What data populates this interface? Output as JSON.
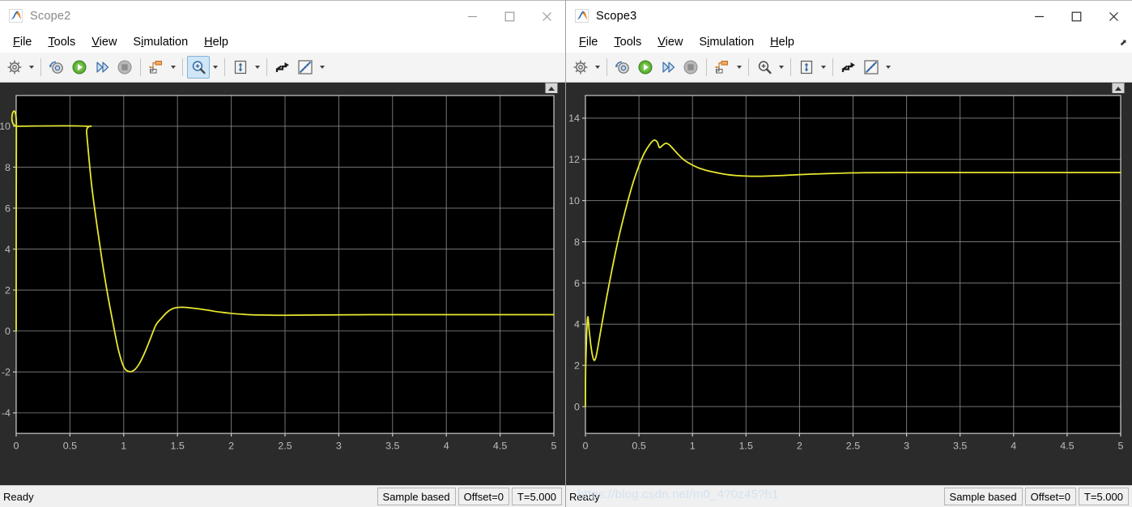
{
  "windows": [
    {
      "id": "scope2",
      "title": "Scope2",
      "active": false,
      "icon": "matlab-scope-icon",
      "menus": [
        {
          "label": "File",
          "mnemonic": "F"
        },
        {
          "label": "Tools",
          "mnemonic": "T"
        },
        {
          "label": "View",
          "mnemonic": "V"
        },
        {
          "label": "Simulation",
          "mnemonic": "i"
        },
        {
          "label": "Help",
          "mnemonic": "H"
        }
      ],
      "window_controls": {
        "minimize": "minimize-button",
        "maximize": "maximize-button",
        "close": "close-button"
      },
      "toolbar": [
        {
          "name": "configuration-properties-icon",
          "caret": true,
          "pressed": false
        },
        {
          "name": "separator"
        },
        {
          "name": "run-back-to-start-icon",
          "caret": false,
          "pressed": false
        },
        {
          "name": "run-icon",
          "caret": false,
          "pressed": false
        },
        {
          "name": "step-forward-icon",
          "caret": false,
          "pressed": false
        },
        {
          "name": "stop-icon",
          "caret": false,
          "pressed": false
        },
        {
          "name": "separator"
        },
        {
          "name": "signal-selection-icon",
          "caret": true,
          "pressed": false
        },
        {
          "name": "separator"
        },
        {
          "name": "zoom-in-icon",
          "caret": true,
          "pressed": true
        },
        {
          "name": "separator"
        },
        {
          "name": "autoscale-icon",
          "caret": true,
          "pressed": false
        },
        {
          "name": "separator"
        },
        {
          "name": "style-icon",
          "caret": false,
          "pressed": false
        },
        {
          "name": "measurements-icon",
          "caret": true,
          "pressed": false
        }
      ],
      "status": {
        "ready": "Ready",
        "sample_mode": "Sample based",
        "offset": "Offset=0",
        "time": "T=5.000"
      },
      "watermark": null
    },
    {
      "id": "scope3",
      "title": "Scope3",
      "active": true,
      "icon": "matlab-scope-icon",
      "menus": [
        {
          "label": "File",
          "mnemonic": "F"
        },
        {
          "label": "Tools",
          "mnemonic": "T"
        },
        {
          "label": "View",
          "mnemonic": "V"
        },
        {
          "label": "Simulation",
          "mnemonic": "i"
        },
        {
          "label": "Help",
          "mnemonic": "H"
        }
      ],
      "window_controls": {
        "minimize": "minimize-button",
        "maximize": "maximize-button",
        "close": "close-button"
      },
      "toolbar": [
        {
          "name": "configuration-properties-icon",
          "caret": true,
          "pressed": false
        },
        {
          "name": "separator"
        },
        {
          "name": "run-back-to-start-icon",
          "caret": false,
          "pressed": false
        },
        {
          "name": "run-icon",
          "caret": false,
          "pressed": false
        },
        {
          "name": "step-forward-icon",
          "caret": false,
          "pressed": false
        },
        {
          "name": "stop-icon",
          "caret": false,
          "pressed": false
        },
        {
          "name": "separator"
        },
        {
          "name": "signal-selection-icon",
          "caret": true,
          "pressed": false
        },
        {
          "name": "separator"
        },
        {
          "name": "zoom-in-icon",
          "caret": true,
          "pressed": false
        },
        {
          "name": "separator"
        },
        {
          "name": "autoscale-icon",
          "caret": true,
          "pressed": false
        },
        {
          "name": "separator"
        },
        {
          "name": "style-icon",
          "caret": false,
          "pressed": false
        },
        {
          "name": "measurements-icon",
          "caret": true,
          "pressed": false
        }
      ],
      "status": {
        "ready": "Ready",
        "sample_mode": "Sample based",
        "offset": "Offset=0",
        "time": "T=5.000"
      },
      "watermark": "https://blog.csdn.net/m0_4?0z45?h1"
    }
  ],
  "theme": {
    "plot_background": "#000000",
    "plot_surround": "#2b2b2b",
    "grid_color": "#8a8a8a",
    "trace_color": "#e8e830",
    "tick_label_color": "#bdbdbd",
    "toolbar_background": "#f4f4f4",
    "pressed_button_background": "#cfe6f7"
  },
  "chart_data": [
    {
      "id": "scope2-plot",
      "type": "line",
      "title": "",
      "xlabel": "",
      "ylabel": "",
      "xlim": [
        0,
        5
      ],
      "ylim": [
        -5,
        11.5
      ],
      "xticks": [
        0,
        0.5,
        1,
        1.5,
        2,
        2.5,
        3,
        3.5,
        4,
        4.5,
        5
      ],
      "xticklabels": [
        "0",
        "0.5",
        "1",
        "1.5",
        "2",
        "2.5",
        "3",
        "3.5",
        "4",
        "4.5",
        "5"
      ],
      "yticks": [
        -4,
        -2,
        0,
        2,
        4,
        6,
        8,
        10
      ],
      "yticklabels": [
        "-4",
        "-2",
        "0",
        "2",
        "4",
        "6",
        "8",
        "10"
      ],
      "grid": true,
      "legend": null,
      "series": [
        {
          "name": "signal",
          "color": "#e8e830",
          "x": [
            0.0,
            0.002,
            0.01,
            0.65,
            0.655,
            0.7,
            0.75,
            0.8,
            0.85,
            0.9,
            0.95,
            1.0,
            1.05,
            1.1,
            1.15,
            1.2,
            1.25,
            1.3,
            1.35,
            1.4,
            1.45,
            1.5,
            1.55,
            1.6,
            1.7,
            1.8,
            1.9,
            2.0,
            2.1,
            2.2,
            2.3,
            2.4,
            2.5,
            2.7,
            3.0,
            3.5,
            4.0,
            4.5,
            5.0
          ],
          "y": [
            0.0,
            10.0,
            10.0,
            10.0,
            9.7,
            7.2,
            5.2,
            3.4,
            1.8,
            0.4,
            -0.9,
            -1.75,
            -1.98,
            -1.9,
            -1.55,
            -1.0,
            -0.35,
            0.3,
            0.62,
            0.9,
            1.08,
            1.15,
            1.16,
            1.14,
            1.08,
            1.0,
            0.92,
            0.86,
            0.82,
            0.79,
            0.78,
            0.77,
            0.77,
            0.78,
            0.79,
            0.8,
            0.8,
            0.8,
            0.8
          ]
        }
      ]
    },
    {
      "id": "scope3-plot",
      "type": "line",
      "title": "",
      "xlabel": "",
      "ylabel": "",
      "xlim": [
        0,
        5
      ],
      "ylim": [
        -1.3,
        15.1
      ],
      "xticks": [
        0,
        0.5,
        1,
        1.5,
        2,
        2.5,
        3,
        3.5,
        4,
        4.5,
        5
      ],
      "xticklabels": [
        "0",
        "0.5",
        "1",
        "1.5",
        "2",
        "2.5",
        "3",
        "3.5",
        "4",
        "4.5",
        "5"
      ],
      "yticks": [
        0,
        2,
        4,
        6,
        8,
        10,
        12,
        14
      ],
      "yticklabels": [
        "0",
        "2",
        "4",
        "6",
        "8",
        "10",
        "12",
        "14"
      ],
      "grid": true,
      "legend": null,
      "series": [
        {
          "name": "signal",
          "color": "#e8e830",
          "x": [
            0.0,
            0.003,
            0.02,
            0.035,
            0.05,
            0.065,
            0.08,
            0.095,
            0.11,
            0.13,
            0.16,
            0.2,
            0.25,
            0.3,
            0.35,
            0.4,
            0.45,
            0.5,
            0.55,
            0.6,
            0.64,
            0.67,
            0.69,
            0.71,
            0.735,
            0.755,
            0.78,
            0.8,
            0.83,
            0.87,
            0.92,
            0.98,
            1.05,
            1.12,
            1.2,
            1.3,
            1.4,
            1.5,
            1.6,
            1.7,
            1.85,
            2.0,
            2.2,
            2.4,
            2.6,
            2.9,
            3.2,
            3.6,
            4.0,
            4.5,
            5.0
          ],
          "y": [
            0.0,
            2.05,
            4.3,
            3.7,
            3.0,
            2.5,
            2.25,
            2.35,
            2.7,
            3.3,
            4.2,
            5.35,
            6.7,
            7.95,
            9.05,
            10.05,
            10.95,
            11.7,
            12.3,
            12.72,
            12.93,
            12.85,
            12.58,
            12.63,
            12.74,
            12.78,
            12.72,
            12.62,
            12.45,
            12.22,
            11.98,
            11.78,
            11.6,
            11.48,
            11.38,
            11.28,
            11.22,
            11.19,
            11.18,
            11.19,
            11.22,
            11.26,
            11.3,
            11.33,
            11.35,
            11.36,
            11.36,
            11.36,
            11.36,
            11.36,
            11.36
          ]
        }
      ]
    }
  ]
}
